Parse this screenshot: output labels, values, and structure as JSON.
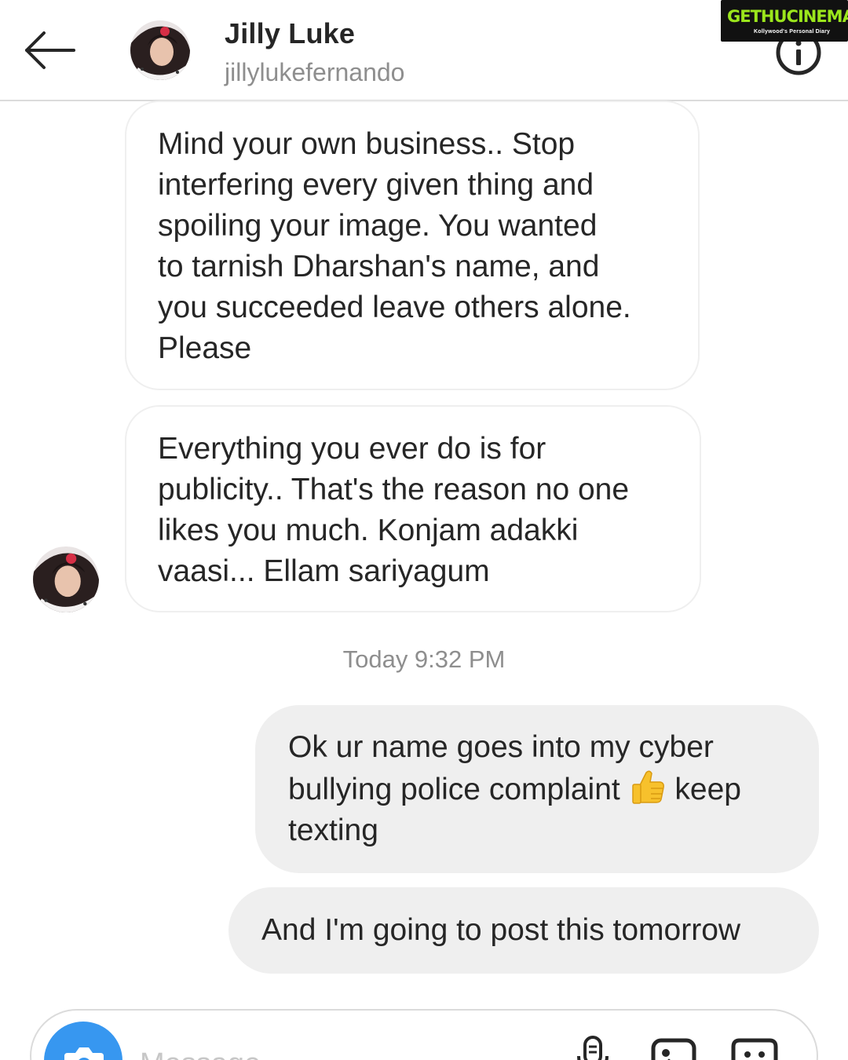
{
  "header": {
    "contact_name": "Jilly Luke",
    "contact_username": "jillylukefernando",
    "back_icon": "arrow-left-icon",
    "info_icon": "info-circle-icon"
  },
  "watermark": {
    "text": "GETHUCINEMA",
    "tagline": "Kollywood's Personal Diary"
  },
  "messages": [
    {
      "direction": "incoming",
      "text": "Mind your own business.. Stop\ninterfering every given thing and\nspoiling your image. You wanted\nto tarnish Dharshan's name, and\nyou succeeded leave others alone.\nPlease"
    },
    {
      "direction": "incoming",
      "text": "Everything you ever do is for\npublicity.. That's the reason no one\nlikes you much. Konjam adakki\nvaasi... Ellam sariyagum"
    },
    {
      "direction": "outgoing",
      "text_before_emoji": "Ok ur name goes into my cyber\nbullying police complaint ",
      "emoji": "thumbs-up",
      "text_after_emoji": " keep\ntexting"
    },
    {
      "direction": "outgoing",
      "text": "And I'm going to post this tomorrow"
    }
  ],
  "timestamp": "Today 9:32 PM",
  "composer": {
    "placeholder": "Message",
    "camera_icon": "camera-icon",
    "mic_icon": "microphone-icon",
    "gallery_icon": "image-icon",
    "sticker_icon": "sticker-icon"
  },
  "colors": {
    "accent": "#3797f0",
    "outgoing_bubble": "#efefef",
    "secondary_text": "#8e8e8e",
    "watermark_green": "#9be61c"
  }
}
